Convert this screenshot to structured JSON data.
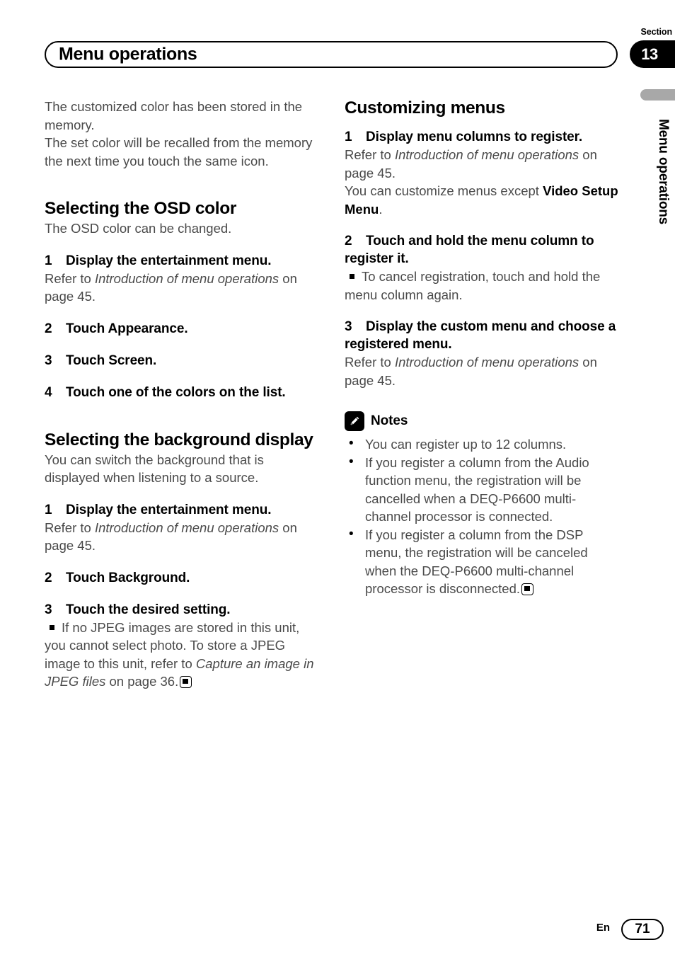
{
  "header": {
    "title": "Menu operations",
    "section_label": "Section",
    "section_number": "13",
    "margin_title": "Menu operations"
  },
  "footer": {
    "language": "En",
    "page_number": "71"
  },
  "left_column": {
    "intro_line1": "The customized color has been stored in the memory.",
    "intro_line2": "The set color will be recalled from the memory the next time you touch the same icon.",
    "osd": {
      "heading": "Selecting the OSD color",
      "description": "The OSD color can be changed.",
      "steps": [
        {
          "num": "1",
          "title": "Display the entertainment menu.",
          "refer_prefix": "Refer to ",
          "refer_italic": "Introduction of menu operations",
          "refer_suffix": " on page 45."
        },
        {
          "num": "2",
          "title": "Touch Appearance."
        },
        {
          "num": "3",
          "title": "Touch Screen."
        },
        {
          "num": "4",
          "title": "Touch one of the colors on the list."
        }
      ]
    },
    "background": {
      "heading": "Selecting the background display",
      "description": "You can switch the background that is displayed when listening to a source.",
      "steps": [
        {
          "num": "1",
          "title": "Display the entertainment menu.",
          "refer_prefix": "Refer to ",
          "refer_italic": "Introduction of menu operations",
          "refer_suffix": " on page 45."
        },
        {
          "num": "2",
          "title": "Touch Background."
        },
        {
          "num": "3",
          "title": "Touch the desired setting."
        }
      ],
      "note_prefix": "If no JPEG images are stored in this unit, you cannot select photo. To store a JPEG image to this unit, refer to ",
      "note_italic": "Capture an image in JPEG files",
      "note_suffix": " on page 36."
    }
  },
  "right_column": {
    "heading": "Customizing menus",
    "steps": [
      {
        "num": "1",
        "title": "Display menu columns to register.",
        "refer_prefix": "Refer to ",
        "refer_italic": "Introduction of menu operations",
        "refer_suffix": " on page 45.",
        "extra_prefix": "You can customize menus except ",
        "extra_bold": "Video Setup Menu",
        "extra_suffix": "."
      },
      {
        "num": "2",
        "title": "Touch and hold the menu column to register it.",
        "square_note": "To cancel registration, touch and hold the menu column again."
      },
      {
        "num": "3",
        "title": "Display the custom menu and choose a registered menu.",
        "refer_prefix": "Refer to ",
        "refer_italic": "Introduction of menu operations",
        "refer_suffix": " on page 45."
      }
    ],
    "notes": {
      "label": "Notes",
      "icon": "pencil-icon",
      "items": [
        "You can register up to 12 columns.",
        "If you register a column from the Audio function menu, the registration will be cancelled when a DEQ-P6600 multi-channel processor is connected.",
        "If you register a column from the DSP menu, the registration will be canceled when the DEQ-P6600 multi-channel processor is disconnected."
      ]
    }
  },
  "colors": {
    "body_text": "#4a4a4a",
    "heading": "#000000",
    "margin_bar": "#a8a8a8"
  }
}
